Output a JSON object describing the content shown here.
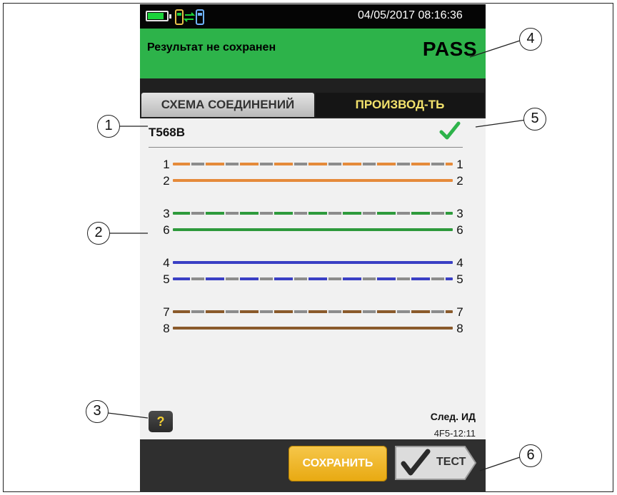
{
  "status": {
    "datetime": "04/05/2017 08:16:36",
    "battery_icon": "battery-icon",
    "link_icon": "link-status-icon"
  },
  "result": {
    "message": "Результат не сохранен",
    "verdict": "PASS"
  },
  "tabs": [
    {
      "label": "СХЕМА СОЕДИНЕНИЙ",
      "active": true
    },
    {
      "label": "ПРОИЗВОД-ТЬ",
      "active": false
    }
  ],
  "wiremap": {
    "standard": "T568B",
    "pass_icon": "checkmark-icon",
    "pairs": [
      {
        "near": "1",
        "far": "1",
        "color": "#e58a3a",
        "striped": true
      },
      {
        "near": "2",
        "far": "2",
        "color": "#e58a3a",
        "striped": false
      },
      {
        "near": "3",
        "far": "3",
        "color": "#2e9a3c",
        "striped": true
      },
      {
        "near": "6",
        "far": "6",
        "color": "#2e9a3c",
        "striped": false
      },
      {
        "near": "4",
        "far": "4",
        "color": "#3a3fc4",
        "striped": false
      },
      {
        "near": "5",
        "far": "5",
        "color": "#3a3fc4",
        "striped": true
      },
      {
        "near": "7",
        "far": "7",
        "color": "#8a5a2b",
        "striped": true
      },
      {
        "near": "8",
        "far": "8",
        "color": "#8a5a2b",
        "striped": false
      }
    ]
  },
  "footer": {
    "help_label": "?",
    "next_id_label": "След. ИД",
    "next_id_value": "4F5-12:11"
  },
  "buttons": {
    "save_label": "СОХРАНИТЬ",
    "test_label": "ТЕСТ"
  },
  "callouts": [
    "1",
    "2",
    "3",
    "4",
    "5",
    "6"
  ]
}
